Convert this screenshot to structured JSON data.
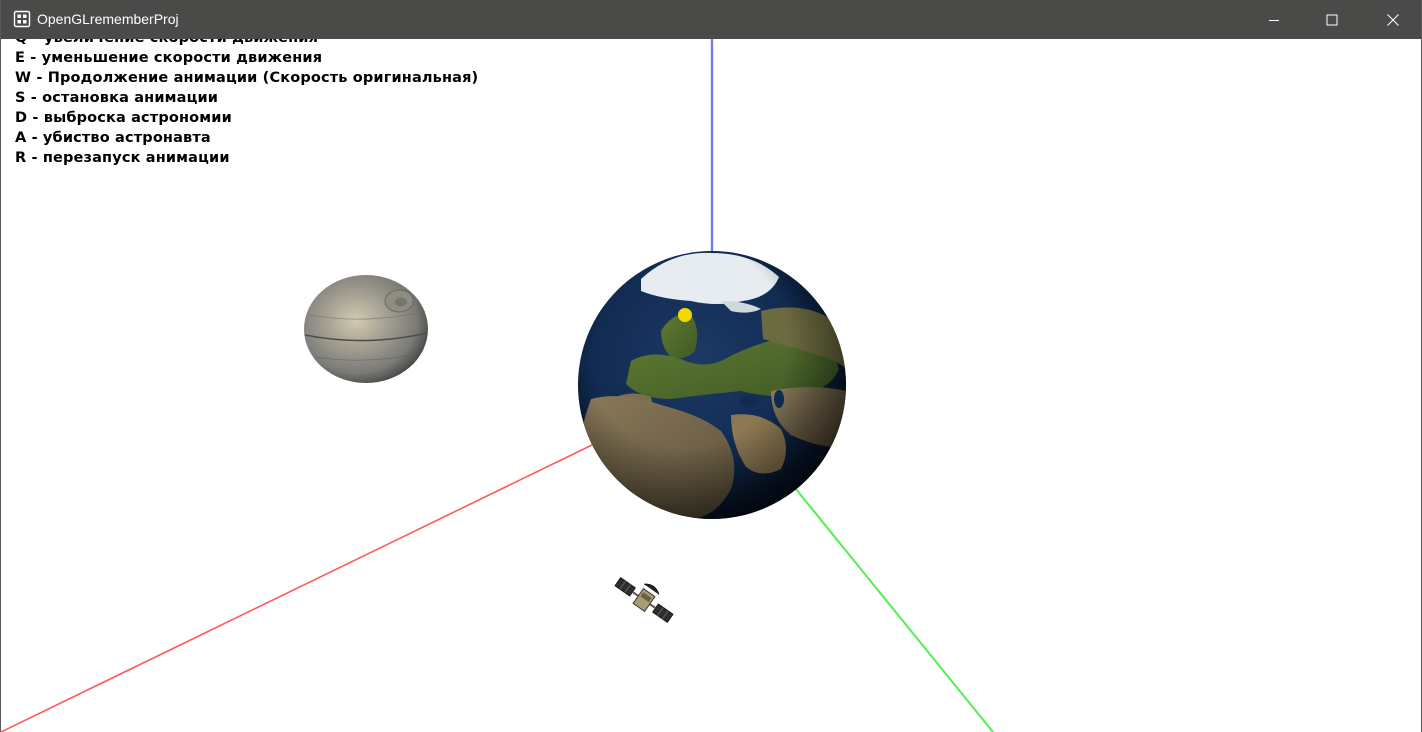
{
  "window": {
    "title": "OpenGLrememberProj",
    "icon": "app-window-icon",
    "controls": {
      "minimize_icon": "minimize-icon",
      "maximize_icon": "maximize-icon",
      "close_icon": "close-icon"
    }
  },
  "help_lines": [
    "Q - увеличение скорости движения",
    "E - уменьшение скорости движения",
    "W - Продолжение анимации (Скорость оригинальная)",
    "S - остановка анимации",
    "D - выброска астрономии",
    "A - убиство астронавта",
    "R - перезапуск анимации"
  ],
  "scene": {
    "background": "#ffffff",
    "axis_colors": {
      "x": "#ff5a5a",
      "y": "#50f050",
      "z": "#7878f0"
    },
    "objects": [
      "earth-globe",
      "death-star-moon",
      "satellite",
      "sun-marker"
    ],
    "sun_color": "#f5d800",
    "earth_ocean": "#0c1e3a",
    "moon_color": "#8c8c86"
  }
}
